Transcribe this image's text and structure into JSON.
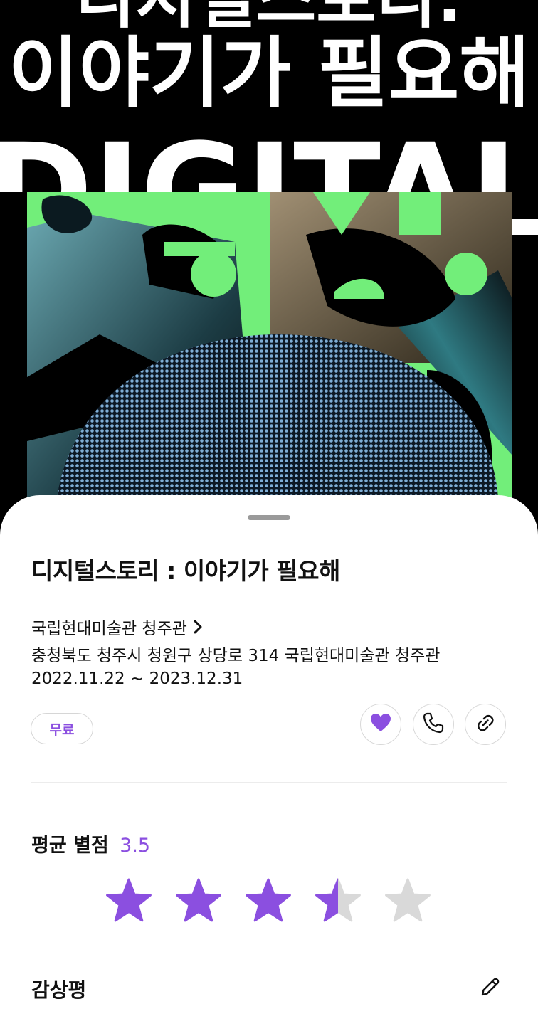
{
  "poster": {
    "headline_korean": "디지털스토리:",
    "headline_korean_2": "이야기가 필요해",
    "headline_english": "DIGITAL"
  },
  "exhibition": {
    "title": "디지털스토리 : 이야기가 필요해",
    "venue": "국립현대미술관 청주관",
    "address": "충청북도 청주시 청원구 상당로 314 국립현대미술관 청주관",
    "period": "2022.11.22 ~ 2023.12.31",
    "price_badge": "무료"
  },
  "actions": {
    "like_icon": "heart-icon",
    "call_icon": "phone-icon",
    "share_icon": "link-icon",
    "liked": true
  },
  "rating": {
    "label": "평균 별점",
    "value": "3.5",
    "score": 3.5,
    "max": 5
  },
  "reviews": {
    "heading": "감상평",
    "edit_icon": "pencil-icon"
  },
  "colors": {
    "accent": "#8b4fe0",
    "poster_green": "#72ee7a",
    "star_empty": "#d9d9d9"
  }
}
